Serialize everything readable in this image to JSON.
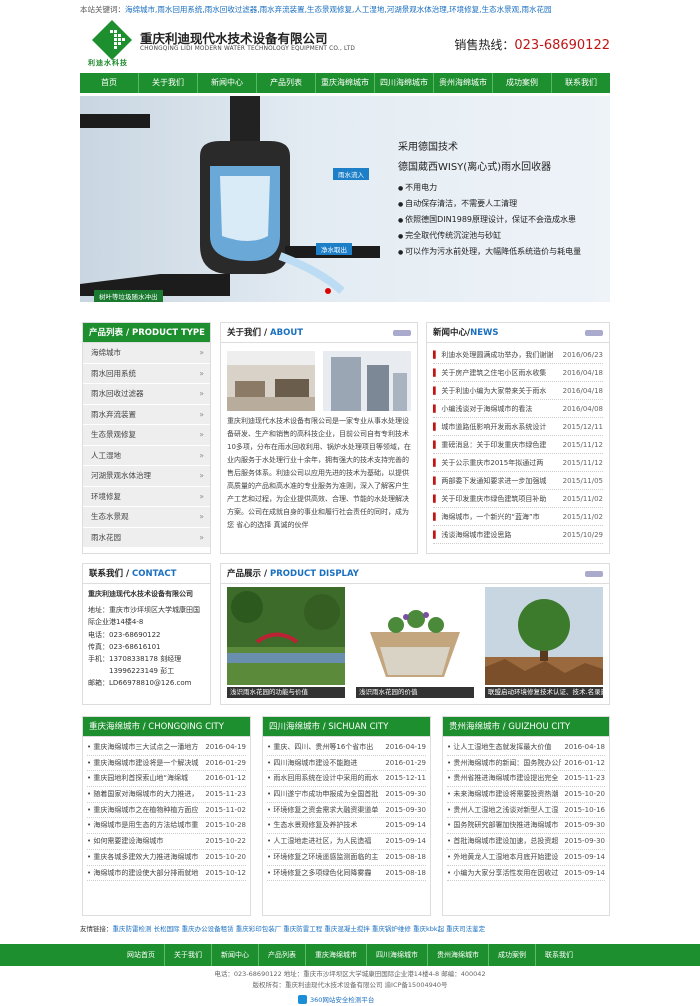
{
  "keywords": {
    "label": "本站关键词：",
    "text": "海绵城市,雨水回用系统,雨水回收过滤器,雨水弃流装置,生态景观修复,人工湿地,河湖景观水体治理,环境修复,生态水景观,雨水花园"
  },
  "header": {
    "logo_text": "利迪水科技",
    "company_name": "重庆利迪现代水技术设备有限公司",
    "company_en": "CHONGQING LIDI MODERN WATER TECHNOLOGY EQUIPMENT CO., LTD",
    "hotline_label": "销售热线：",
    "hotline_number": "023-68690122"
  },
  "nav": [
    "首页",
    "关于我们",
    "新闻中心",
    "产品列表",
    "重庆海绵城市",
    "四川海绵城市",
    "贵州海绵城市",
    "成功案例",
    "联系我们"
  ],
  "banner": {
    "line1": "采用德国技术",
    "line2": "德国葳西WISY(离心式)雨水回收器",
    "bullets": [
      "不用电力",
      "自动保存清洁，不需要人工清理",
      "依照德国DIN1989原理设计，保证不会造成水患",
      "完全取代传统沉淀池与砂缸",
      "可以作为污水前处理，大幅降低系统造价与耗电量"
    ],
    "label_in": "雨水流入",
    "label_out": "净水取出",
    "label_leaf": "树叶等垃圾随水冲出"
  },
  "products": {
    "title": "产品列表 / PRODUCT TYPE",
    "items": [
      "海绵城市",
      "雨水回用系统",
      "雨水回收过滤器",
      "雨水弃流装置",
      "生态景观修复",
      "人工湿地",
      "河湖景观水体治理",
      "环境修复",
      "生态水景观",
      "雨水花园"
    ]
  },
  "about": {
    "title_cn": "关于我们 / ",
    "title_en": "ABOUT",
    "text": "重庆利迪现代水技术设备有限公司是一家专业从事水处理设备研发、生产和销售的高科技企业，目前公司自有专利技术10多项，分布在雨水回收利用、锅炉水处理项目等领域，在业内服务于水处理行业十余年，拥有强大的技术支持完善的售后服务体系。利迪公司以应用先进的技术为基础，以提供高质量的产品和高水准的专业服务为准则，深入了解客户生产工艺和过程，为企业提供高效、合理、节能的水处理解决方案。公司在成就自身的事业和履行社会责任的同时，成为您 省心的选择 真诚的伙伴"
  },
  "news": {
    "title_cn": "新闻中心/",
    "title_en": "NEWS",
    "items": [
      {
        "title": "利迪水处理圆满成功举办，我们谢谢",
        "date": "2016/06/23"
      },
      {
        "title": "关于房产建筑之住宅小区雨水收集",
        "date": "2016/04/18"
      },
      {
        "title": "关于利迪小编为大家带来关于雨水",
        "date": "2016/04/18"
      },
      {
        "title": "小编浅谈对于海绵城市的看法",
        "date": "2016/04/08"
      },
      {
        "title": "城市道路低影响开发雨水系统设计",
        "date": "2015/12/11"
      },
      {
        "title": "重磅消息：关于印发重庆市绿色建",
        "date": "2015/11/12"
      },
      {
        "title": "关于公示重庆市2015年拟通过两",
        "date": "2015/11/12"
      },
      {
        "title": "两部委下发通知要求进一步加强城",
        "date": "2015/11/05"
      },
      {
        "title": "关于印发重庆市绿色建筑项目补助",
        "date": "2015/11/02"
      },
      {
        "title": "海绵城市，一个新兴的“蓝海”市",
        "date": "2015/11/02"
      },
      {
        "title": "浅谈海绵城市建设思路",
        "date": "2015/10/29"
      }
    ]
  },
  "contact": {
    "title_cn": "联系我们 / ",
    "title_en": "CONTACT",
    "company": "重庆利迪现代水技术设备有限公司",
    "lines": [
      "地址：重庆市沙坪坝区大学城康田国际企业港14楼4-8",
      "电话：023-68690122",
      "传真：023-68616101",
      "手机：13708338178 刻经理",
      "　　　13996223149 彭工",
      "邮箱：LD66978810@126.com"
    ]
  },
  "display": {
    "title_cn": "产品展示 / ",
    "title_en": "PRODUCT DISPLAY",
    "items": [
      "浅识雨水花园的功能与价值",
      "浅识雨水花园的价值",
      "联盟启动环境修复技术认证、技术.名录建"
    ]
  },
  "chongqing": {
    "title": "重庆海绵城市 / CHONGQING CITY",
    "items": [
      {
        "title": "重庆海绵城市三大试点之一潘地方",
        "date": "2016-04-19"
      },
      {
        "title": "重庆海绵城市建设将是一个解决城",
        "date": "2016-01-29"
      },
      {
        "title": "重庆园地利首探索山地“海绵城",
        "date": "2016-01-12"
      },
      {
        "title": "随着国家对海绵城市的大力推进，",
        "date": "2015-11-23"
      },
      {
        "title": "重庆海绵城市之在植物种植方面应",
        "date": "2015-11-02"
      },
      {
        "title": "海绵城市是用生态的方法给城市重",
        "date": "2015-10-28"
      },
      {
        "title": "如何需要建设海绵城市",
        "date": "2015-10-22"
      },
      {
        "title": "重庆各城多建效大力推进海绵城市",
        "date": "2015-10-20"
      },
      {
        "title": "海绵城市的建设使大部分排雨就地",
        "date": "2015-10-12"
      }
    ]
  },
  "sichuan": {
    "title": "四川海绵城市 / SICHUAN CITY",
    "items": [
      {
        "title": "重庆、四川、贵州等16个省市出",
        "date": "2016-04-19"
      },
      {
        "title": "四川海绵城市建设不能跑进",
        "date": "2016-01-29"
      },
      {
        "title": "雨水回用系统在设计中采用的雨水",
        "date": "2015-12-11"
      },
      {
        "title": "四川遂宁市成功申报成为全国首批",
        "date": "2015-09-30"
      },
      {
        "title": "环境修复之资金需求大融资渠道单",
        "date": "2015-09-30"
      },
      {
        "title": "生态水景观修复及养护技术",
        "date": "2015-09-14"
      },
      {
        "title": "人工湿地走进社区，为人民造福",
        "date": "2015-09-14"
      },
      {
        "title": "环境修复之环境遥感监测面临的主",
        "date": "2015-08-18"
      },
      {
        "title": "环境修复之多项绿色化同降雾霾",
        "date": "2015-08-18"
      }
    ]
  },
  "guizhou": {
    "title": "贵州海绵城市 / GUIZHOU CITY",
    "items": [
      {
        "title": "让人工湿地生态就发挥最大价值",
        "date": "2016-04-18"
      },
      {
        "title": "贵州海绵城市的新闻：国务院办公厅",
        "date": "2016-01-12"
      },
      {
        "title": "贵州省推进海绵城市建设提出完全",
        "date": "2015-11-23"
      },
      {
        "title": "未来海绵城市建设将需要投资热潮",
        "date": "2015-10-20"
      },
      {
        "title": "贵州人工湿地之浅谈对新型人工湿",
        "date": "2015-10-16"
      },
      {
        "title": "国务院研究部署加快推进海绵城市",
        "date": "2015-09-30"
      },
      {
        "title": "首批海绵城市建设加速，总投资超",
        "date": "2015-09-30"
      },
      {
        "title": "外地黄龙人工湿地本月底开始建设",
        "date": "2015-09-14"
      },
      {
        "title": "小编为大家分享活性炭用在因收过",
        "date": "2015-09-14"
      }
    ]
  },
  "links": {
    "label": "友情链接：",
    "text": "重庆防雷检测 长松国际 重庆办公设备租赁 重庆彩印包装厂 重庆防雷工程 重庆混凝土搅拌 重庆锅炉维修 重庆kbk起 重庆司法鉴定"
  },
  "footer_nav": [
    "网站首页",
    "关于我们",
    "新闻中心",
    "产品列表",
    "重庆海绵城市",
    "四川海绵城市",
    "贵州海绵城市",
    "成功案例",
    "联系我们"
  ],
  "footer": {
    "line1": "电话：023-68690122 地址：重庆市沙坪坝区大学城康田国际企业港14楼4-8 邮编：400042",
    "line2": "版权所有：重庆利迪现代水技术设备有限公司 渝ICP备15004940号",
    "badge": "360网站安全检测平台"
  }
}
